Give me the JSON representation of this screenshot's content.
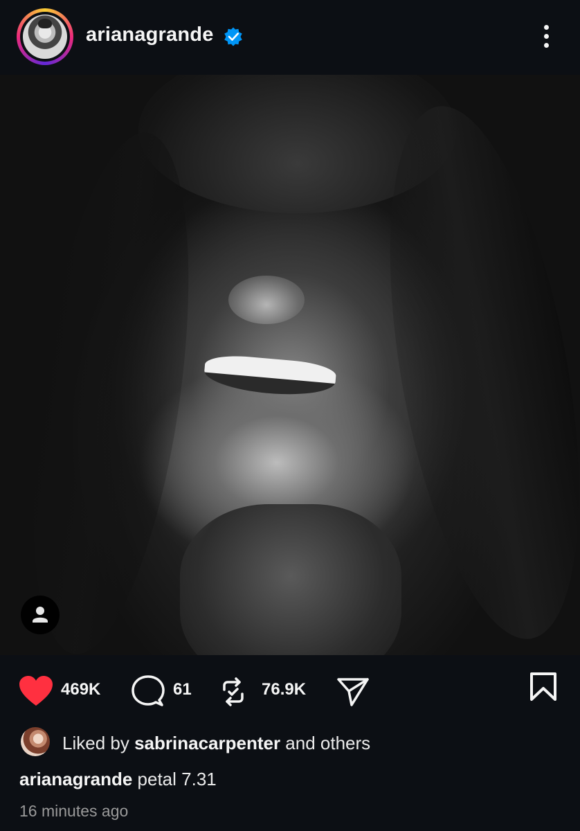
{
  "post": {
    "username": "arianagrande",
    "verified": true,
    "photo_icon": "tagged-people-icon",
    "likes_count": "469K",
    "comments_count": "61",
    "reposts_count": "76.9K",
    "liked_by_prefix": "Liked by",
    "liked_by_user": "sabrinacarpenter",
    "liked_by_suffix": "and others",
    "caption_user": "arianagrande",
    "caption_text": "petal 7.31",
    "timestamp": "16 minutes ago"
  },
  "colors": {
    "background": "#0c0f14",
    "like_red": "#ff3040",
    "verified_blue": "#0095f6"
  },
  "icons": [
    "more-icon",
    "heart-icon",
    "comment-icon",
    "repost-icon",
    "share-icon",
    "save-icon",
    "verified-badge-icon",
    "person-icon"
  ]
}
